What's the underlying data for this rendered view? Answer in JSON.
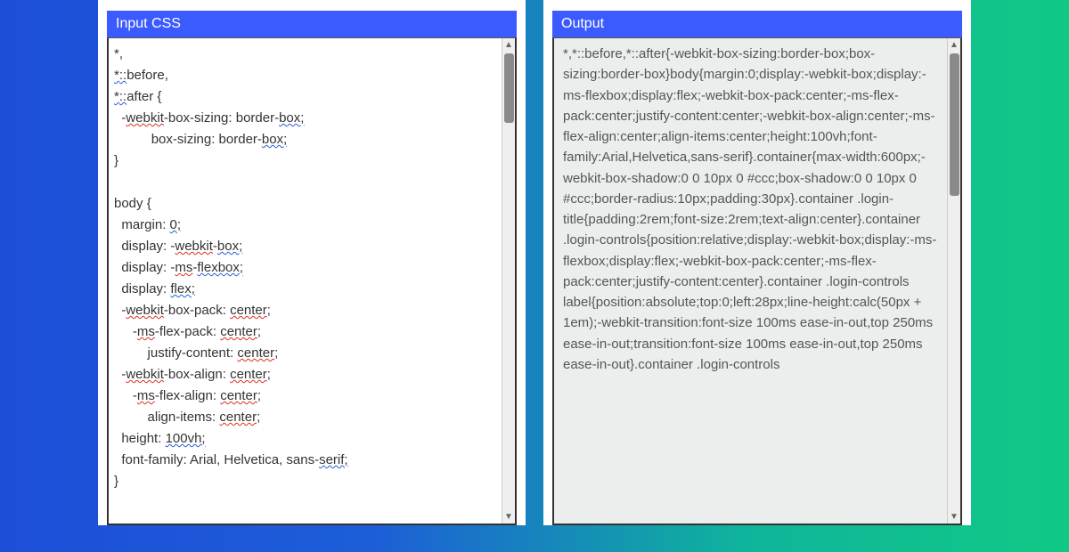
{
  "input": {
    "title": "Input CSS",
    "lines": [
      [
        {
          "t": "*,"
        }
      ],
      [
        {
          "t": "*",
          "c": "lk"
        },
        {
          "t": "::",
          "c": "lk"
        },
        {
          "t": "before,"
        }
      ],
      [
        {
          "t": "*",
          "c": "lk"
        },
        {
          "t": "::",
          "c": "lk"
        },
        {
          "t": "after {"
        }
      ],
      [
        {
          "t": "  -"
        },
        {
          "t": "webkit",
          "c": "sp"
        },
        {
          "t": "-box-sizing: border-"
        },
        {
          "t": "box;",
          "c": "lk"
        }
      ],
      [
        {
          "t": "          box-sizing: border-"
        },
        {
          "t": "box;",
          "c": "lk"
        }
      ],
      [
        {
          "t": "}"
        }
      ],
      [
        {
          "t": ""
        }
      ],
      [
        {
          "t": "body {"
        }
      ],
      [
        {
          "t": "  margin: "
        },
        {
          "t": "0;",
          "c": "lk"
        }
      ],
      [
        {
          "t": "  display: -"
        },
        {
          "t": "webkit",
          "c": "sp"
        },
        {
          "t": "-"
        },
        {
          "t": "box;",
          "c": "lk"
        }
      ],
      [
        {
          "t": "  display: -"
        },
        {
          "t": "ms",
          "c": "sp"
        },
        {
          "t": "-"
        },
        {
          "t": "flexbox;",
          "c": "lk"
        }
      ],
      [
        {
          "t": "  display: "
        },
        {
          "t": "flex;",
          "c": "lk"
        }
      ],
      [
        {
          "t": "  -"
        },
        {
          "t": "webkit",
          "c": "sp"
        },
        {
          "t": "-box-pack: "
        },
        {
          "t": "center",
          "c": "sp"
        },
        {
          "t": ";"
        }
      ],
      [
        {
          "t": "     -"
        },
        {
          "t": "ms",
          "c": "sp"
        },
        {
          "t": "-flex-pack: "
        },
        {
          "t": "center",
          "c": "sp"
        },
        {
          "t": ";"
        }
      ],
      [
        {
          "t": "         justify-content: "
        },
        {
          "t": "center",
          "c": "sp"
        },
        {
          "t": ";"
        }
      ],
      [
        {
          "t": "  -"
        },
        {
          "t": "webkit",
          "c": "sp"
        },
        {
          "t": "-box-align: "
        },
        {
          "t": "center",
          "c": "sp"
        },
        {
          "t": ";"
        }
      ],
      [
        {
          "t": "     -"
        },
        {
          "t": "ms",
          "c": "sp"
        },
        {
          "t": "-flex-align: "
        },
        {
          "t": "center",
          "c": "sp"
        },
        {
          "t": ";"
        }
      ],
      [
        {
          "t": "         align-items: "
        },
        {
          "t": "center",
          "c": "sp"
        },
        {
          "t": ";"
        }
      ],
      [
        {
          "t": "  height: "
        },
        {
          "t": "100vh;",
          "c": "lk"
        }
      ],
      [
        {
          "t": "  font-family: Arial, Helvetica, sans-"
        },
        {
          "t": "serif;",
          "c": "lk"
        }
      ],
      [
        {
          "t": "}"
        }
      ]
    ]
  },
  "output": {
    "title": "Output",
    "text": "*,*::before,*::after{-webkit-box-sizing:border-box;box-sizing:border-box}body{margin:0;display:-webkit-box;display:-ms-flexbox;display:flex;-webkit-box-pack:center;-ms-flex-pack:center;justify-content:center;-webkit-box-align:center;-ms-flex-align:center;align-items:center;height:100vh;font-family:Arial,Helvetica,sans-serif}.container{max-width:600px;-webkit-box-shadow:0 0 10px 0 #ccc;box-shadow:0 0 10px 0 #ccc;border-radius:10px;padding:30px}.container .login-title{padding:2rem;font-size:2rem;text-align:center}.container .login-controls{position:relative;display:-webkit-box;display:-ms-flexbox;display:flex;-webkit-box-pack:center;-ms-flex-pack:center;justify-content:center}.container .login-controls label{position:absolute;top:0;left:28px;line-height:calc(50px + 1em);-webkit-transition:font-size 100ms ease-in-out,top 250ms ease-in-out;transition:font-size 100ms ease-in-out,top 250ms ease-in-out}.container .login-controls"
  }
}
